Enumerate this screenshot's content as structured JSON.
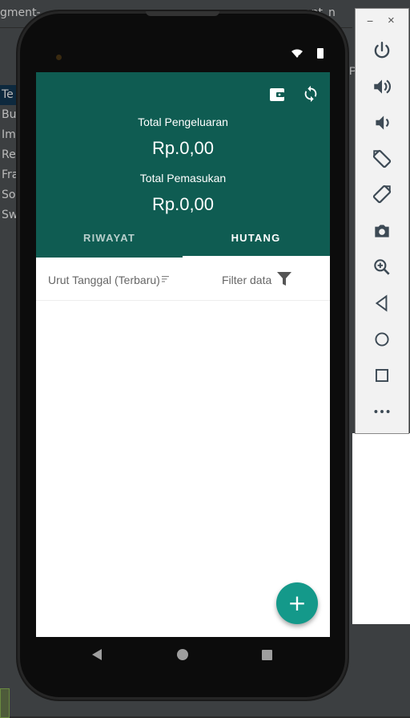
{
  "ide": {
    "tab_left": "gment-",
    "tab_right": "ent_n",
    "right_clip": "P",
    "tree_items": [
      "Te",
      "Bu",
      "Im",
      "Re",
      "Fra",
      "So",
      "Sw"
    ]
  },
  "app": {
    "expense_label": "Total Pengeluaran",
    "expense_value": "Rp.0,00",
    "income_label": "Total Pemasukan",
    "income_value": "Rp.0,00",
    "tabs": [
      {
        "label": "RIWAYAT",
        "active": false
      },
      {
        "label": "HUTANG",
        "active": true
      }
    ],
    "sort_label": "Urut Tanggal (Terbaru)",
    "filter_label": "Filter data",
    "fab_symbol": "+",
    "icons": [
      "wallet-icon",
      "sync-icon",
      "sort-icon",
      "filter-icon",
      "add-icon"
    ]
  },
  "colors": {
    "primary": "#0f5c52",
    "accent": "#14998a"
  },
  "emulator": {
    "minimize": "−",
    "close": "×",
    "buttons": [
      "power-icon",
      "volume-up-icon",
      "volume-down-icon",
      "rotate-left-icon",
      "rotate-right-icon",
      "camera-icon",
      "zoom-icon",
      "back-icon",
      "home-icon",
      "overview-icon",
      "more-icon"
    ]
  }
}
